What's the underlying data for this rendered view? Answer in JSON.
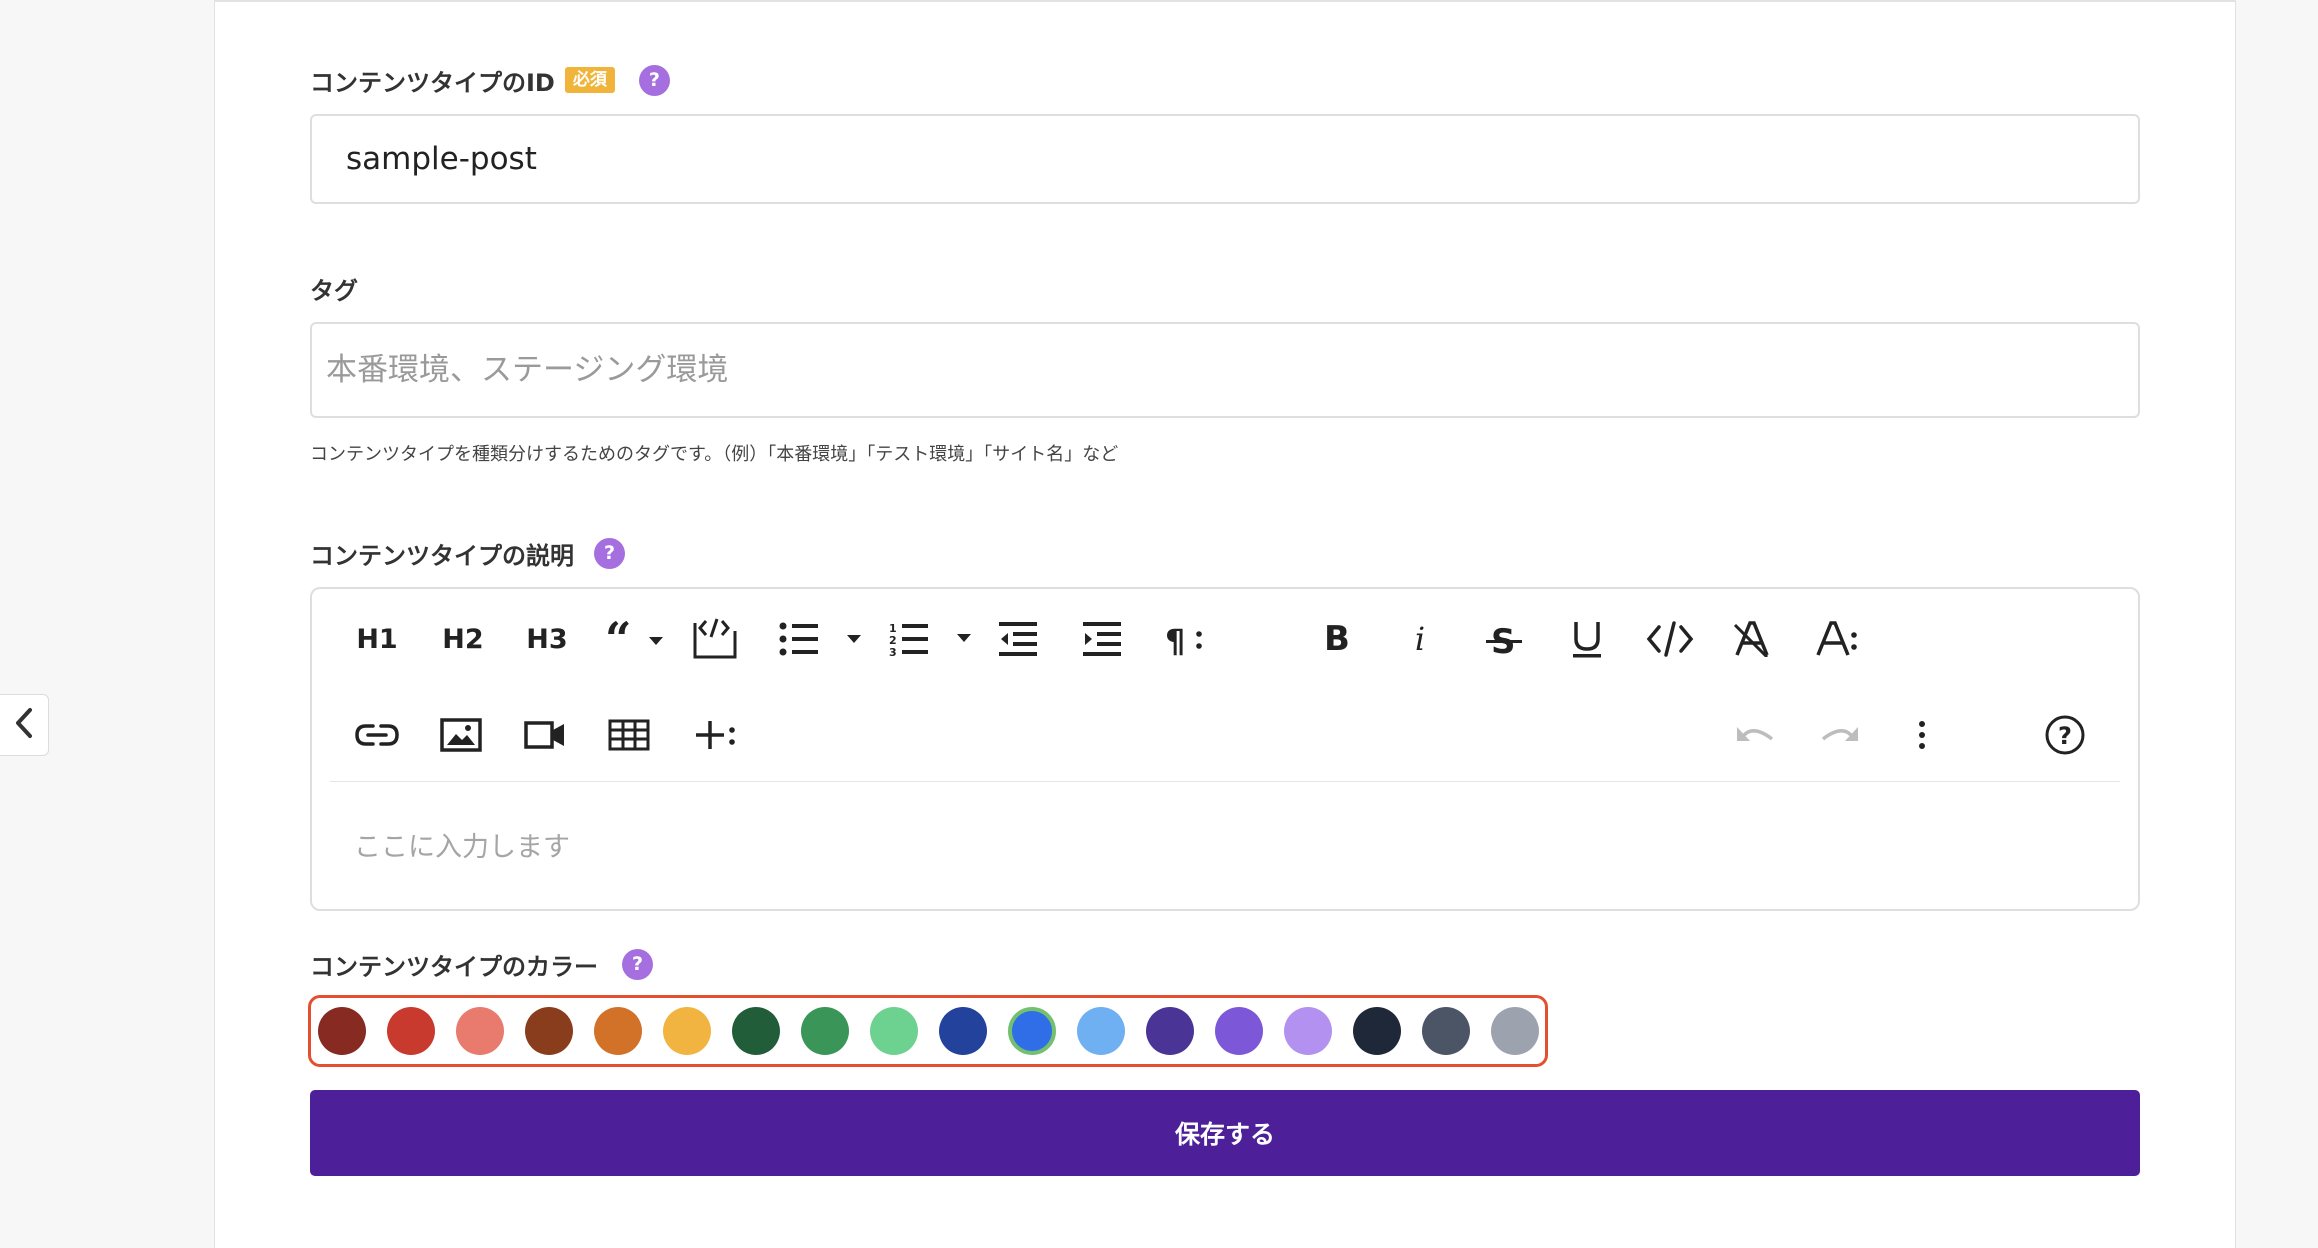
{
  "form": {
    "id_field": {
      "label": "コンテンツタイプのID",
      "required_badge": "必須",
      "help": "?",
      "value": "sample-post"
    },
    "tag_field": {
      "label": "タグ",
      "placeholder": "本番環境、ステージング環境",
      "hint": "コンテンツタイプを種類分けするためのタグです。（例）「本番環境」「テスト環境」「サイト名」など"
    },
    "description_field": {
      "label": "コンテンツタイプの説明",
      "help": "?",
      "editor": {
        "toolbar_row1": [
          "H1",
          "H2",
          "H3",
          "quote-dropdown",
          "code-block",
          "bullet-list-dropdown",
          "numbered-list-dropdown",
          "outdent",
          "indent",
          "paragraph-more",
          "bold",
          "italic",
          "strikethrough",
          "underline",
          "inline-code",
          "clear-format",
          "text-more"
        ],
        "toolbar_row2": [
          "link",
          "image",
          "video",
          "table",
          "insert-more",
          "undo",
          "redo",
          "more-options",
          "help"
        ],
        "h1": "H1",
        "h2": "H2",
        "h3": "H3",
        "bold": "B",
        "italic": "i",
        "placeholder": "ここに入力します"
      }
    },
    "color_field": {
      "label": "コンテンツタイプのカラー",
      "help": "?",
      "colors": [
        "#862a22",
        "#c93a2e",
        "#e87a6e",
        "#8a3d1c",
        "#d27229",
        "#f2b441",
        "#225d3a",
        "#3a9558",
        "#6dd18f",
        "#22429c",
        "#2f6ee6",
        "#6eb0f2",
        "#4a3597",
        "#7c58d8",
        "#b291f0",
        "#1e2838",
        "#4b5566",
        "#9ca3af"
      ],
      "selected_index": 10
    },
    "save_label": "保存する"
  }
}
